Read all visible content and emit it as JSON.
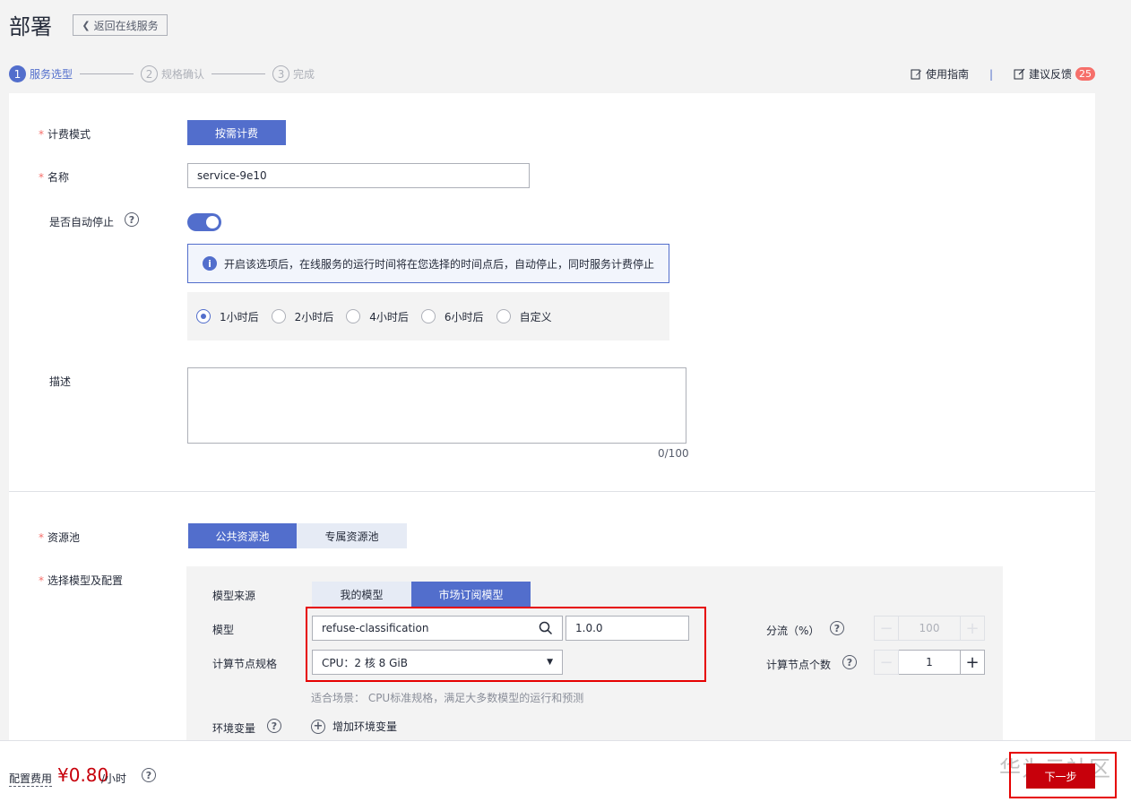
{
  "header": {
    "title": "部署",
    "back_label": "返回在线服务"
  },
  "steps": [
    {
      "num": "1",
      "label": "服务选型"
    },
    {
      "num": "2",
      "label": "规格确认"
    },
    {
      "num": "3",
      "label": "完成"
    }
  ],
  "top_links": {
    "guide": "使用指南",
    "separator": "|",
    "feedback": "建议反馈",
    "feedback_count": "25"
  },
  "form": {
    "billing": {
      "label": "计费模式",
      "value": "按需计费"
    },
    "name": {
      "label": "名称",
      "value": "service-9e10"
    },
    "auto_stop": {
      "label": "是否自动停止",
      "enabled": true,
      "info": "开启该选项后，在线服务的运行时间将在您选择的时间点后，自动停止，同时服务计费停止",
      "options": [
        "1小时后",
        "2小时后",
        "4小时后",
        "6小时后",
        "自定义"
      ],
      "selected": "1小时后"
    },
    "description": {
      "label": "描述",
      "counter": "0/100"
    },
    "resource_pool": {
      "label": "资源池",
      "options": [
        "公共资源池",
        "专属资源池"
      ],
      "selected": "公共资源池"
    },
    "model_config": {
      "label": "选择模型及配置",
      "source_label": "模型来源",
      "source_options": [
        "我的模型",
        "市场订阅模型"
      ],
      "source_selected": "市场订阅模型",
      "model_label": "模型",
      "model_value": "refuse-classification",
      "version_value": "1.0.0",
      "spec_label": "计算节点规格",
      "spec_value": "CPU：2 核 8 GiB",
      "hint": "适合场景： CPU标准规格，满足大多数模型的运行和预测",
      "env_label": "环境变量",
      "env_add": "增加环境变量",
      "traffic_label": "分流（%）",
      "traffic_value": "100",
      "nodes_label": "计算节点个数",
      "nodes_value": "1"
    }
  },
  "footer": {
    "fee_label": "配置费用",
    "price": "¥0.80",
    "unit": "/小时",
    "next": "下一步"
  },
  "watermark": "华为云社区",
  "colors": {
    "primary": "#526ecc",
    "danger": "#c7000b",
    "highlight_box": "#e60000"
  }
}
